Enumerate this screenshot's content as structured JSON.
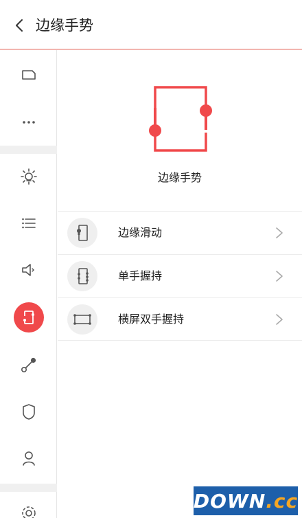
{
  "header": {
    "title": "边缘手势"
  },
  "sidebar": {
    "items": [
      {
        "name": "tag-icon"
      },
      {
        "name": "more-icon"
      },
      {
        "name": "brightness-icon"
      },
      {
        "name": "list-icon"
      },
      {
        "name": "volume-icon"
      },
      {
        "name": "edge-gesture-icon",
        "active": true
      },
      {
        "name": "shortcut-icon"
      },
      {
        "name": "shield-icon"
      },
      {
        "name": "user-icon"
      },
      {
        "name": "settings-icon"
      }
    ]
  },
  "hero": {
    "title": "边缘手势"
  },
  "options": [
    {
      "label": "边缘滑动",
      "icon": "edge-swipe-icon"
    },
    {
      "label": "单手握持",
      "icon": "one-hand-grip-icon"
    },
    {
      "label": "横屏双手握持",
      "icon": "landscape-two-hand-icon"
    }
  ],
  "colors": {
    "accent": "#f0494b",
    "divider": "#e2574c",
    "icon_gray": "#555555"
  },
  "watermark": {
    "text_main": "DOWN",
    "text_suffix": ".cc"
  }
}
